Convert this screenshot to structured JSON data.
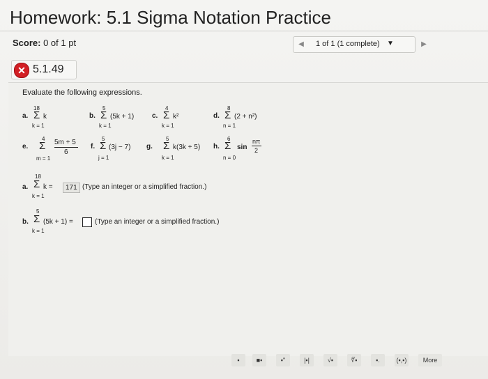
{
  "header": {
    "title": "Homework: 5.1 Sigma Notation Practice"
  },
  "score": {
    "label": "Score:",
    "value": "0 of 1 pt"
  },
  "question_nav": {
    "label": "1 of 1 (1 complete)"
  },
  "question": {
    "id": "5.1.49"
  },
  "instructions": "Evaluate the following expressions.",
  "problems": {
    "a": {
      "label": "a.",
      "upper": "18",
      "lower": "k = 1",
      "body": "k"
    },
    "b": {
      "label": "b.",
      "upper": "5",
      "lower": "k = 1",
      "body": "(5k + 1)"
    },
    "c": {
      "label": "c.",
      "upper": "4",
      "lower": "k = 1",
      "body": "k²"
    },
    "d": {
      "label": "d.",
      "upper": "8",
      "lower": "n = 1",
      "body": "(2 + n²)"
    },
    "e": {
      "label": "e.",
      "upper": "4",
      "lower": "m = 1",
      "num": "5m + 5",
      "den": "6"
    },
    "f": {
      "label": "f.",
      "upper": "5",
      "lower": "j = 1",
      "body": "(3j − 7)"
    },
    "g": {
      "label": "g.",
      "upper": "5",
      "lower": "k = 1",
      "body": "k(3k + 5)"
    },
    "h": {
      "label": "h.",
      "upper": "6",
      "lower": "n = 0",
      "body": "sin",
      "num": "nπ",
      "den": "2"
    }
  },
  "answers": {
    "a": {
      "label": "a.",
      "upper": "18",
      "lower": "k = 1",
      "body": "k =",
      "value": "171",
      "hint": "(Type an integer or a simplified fraction.)"
    },
    "b": {
      "label": "b.",
      "upper": "5",
      "lower": "k = 1",
      "body": "(5k + 1) =",
      "hint": "(Type an integer or a simplified fraction.)"
    }
  },
  "sigma": "Σ",
  "toolbar": {
    "more_label": "More"
  }
}
